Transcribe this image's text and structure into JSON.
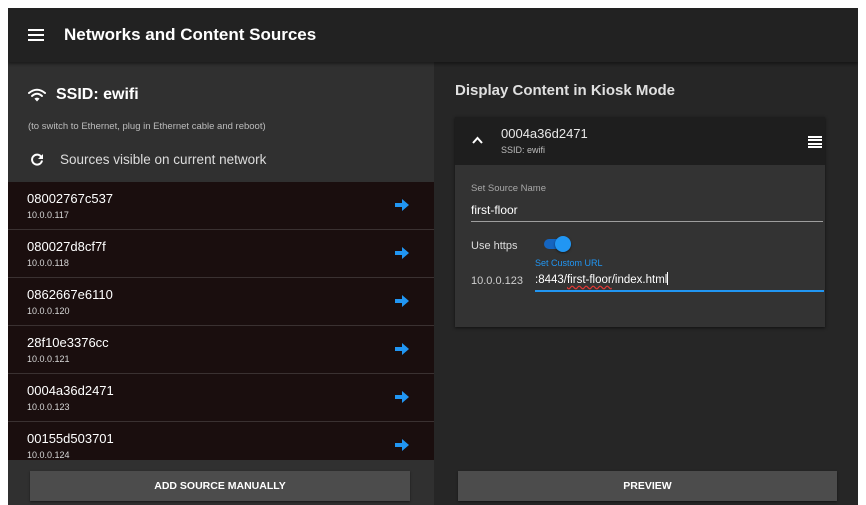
{
  "appbar": {
    "title": "Networks and Content Sources",
    "menu_icon": "hamburger-icon"
  },
  "left": {
    "ssid": "SSID: ewifi",
    "wifi_icon": "wifi-icon",
    "hint": "(to switch to Ethernet, plug in Ethernet cable and reboot)",
    "refresh_icon": "refresh-icon",
    "visible_label": "Sources visible on current network",
    "sources": [
      {
        "name": "08002767c537",
        "ip": "10.0.0.117"
      },
      {
        "name": "080027d8cf7f",
        "ip": "10.0.0.118"
      },
      {
        "name": "0862667e6110",
        "ip": "10.0.0.120"
      },
      {
        "name": "28f10e3376cc",
        "ip": "10.0.0.121"
      },
      {
        "name": "0004a36d2471",
        "ip": "10.0.0.123"
      },
      {
        "name": "00155d503701",
        "ip": "10.0.0.124"
      }
    ],
    "arrow_icon": "arrow-right-icon",
    "add_button": "ADD SOURCE MANUALLY"
  },
  "right": {
    "title": "Display Content in Kiosk Mode",
    "card": {
      "name": "0004a36d2471",
      "ssid": "SSID: ewifi",
      "collapse_icon": "chevron-up-icon",
      "menu_icon": "menu-icon",
      "source_name_label": "Set Source Name",
      "source_name_value": "first-floor",
      "https_label": "Use https",
      "https_enabled": true,
      "custom_url_link": "Set Custom URL",
      "ip_prefix": "10.0.0.123",
      "url_pre": ":8443/",
      "url_misspelled": "first-floor",
      "url_post": "/index.html"
    },
    "preview_button": "PREVIEW"
  },
  "colors": {
    "accent": "#2196f3",
    "appbar": "#222222",
    "list_background": "#1a0e0e",
    "button": "#4c4c4c"
  }
}
